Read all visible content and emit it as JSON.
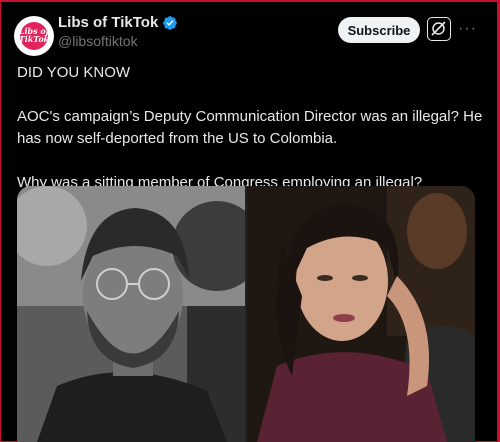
{
  "author": {
    "display_name": "Libs of TikTok",
    "handle": "@libsoftiktok",
    "avatar_text": "Libs of TikTok",
    "verified": true
  },
  "actions": {
    "subscribe_label": "Subscribe",
    "grok_icon": "grok-icon",
    "more_icon": "more-icon",
    "more_glyph": "···"
  },
  "post": {
    "paragraphs": [
      "DID YOU KNOW",
      "AOC's campaign’s Deputy Communication Director was an illegal? He has now self-deported from the US to Colombia.",
      "Why was a sitting member of Congress employing an illegal?"
    ]
  },
  "colors": {
    "background": "#000000",
    "text": "#e7e9ea",
    "muted": "#71767b",
    "verified": "#1d9bf0",
    "frame": "#c8102e"
  }
}
